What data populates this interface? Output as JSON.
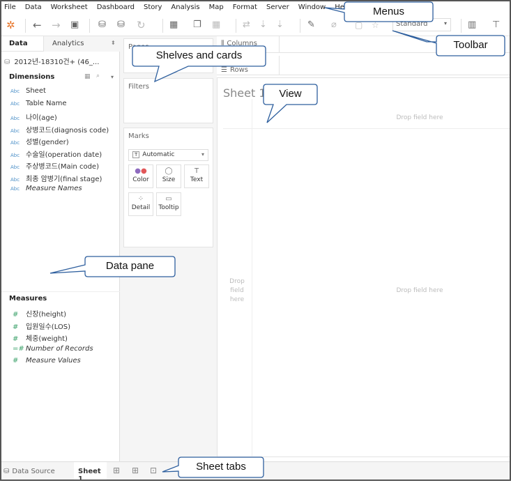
{
  "menus": [
    "File",
    "Data",
    "Worksheet",
    "Dashboard",
    "Story",
    "Analysis",
    "Map",
    "Format",
    "Server",
    "Window",
    "Help"
  ],
  "toolbar": {
    "icons": [
      "tableau-logo-icon",
      "back-icon",
      "forward-icon",
      "save-icon",
      "new-datasource-icon",
      "pause-updates-icon",
      "refresh-icon",
      "new-worksheet-icon",
      "duplicate-sheet-icon",
      "clear-sheet-icon",
      "swap-icon",
      "sort-ascending-icon",
      "sort-descending-icon",
      "highlight-icon",
      "group-icon",
      "label-icon",
      "pin-icon",
      "show-me-icon",
      "presentation-icon"
    ],
    "fit_select": "Standard"
  },
  "data_pane": {
    "tabs": [
      "Data",
      "Analytics"
    ],
    "datasource": "2012년-18310건+ (46_...",
    "dimensions_label": "Dimensions",
    "dimensions": [
      {
        "type": "Abc",
        "name": "Sheet",
        "italic": false
      },
      {
        "type": "Abc",
        "name": "Table Name",
        "italic": false
      },
      {
        "type": "Abc",
        "name": "나이(age)",
        "italic": false
      },
      {
        "type": "Abc",
        "name": "상병코드(diagnosis code)",
        "italic": false
      },
      {
        "type": "Abc",
        "name": "성별(gender)",
        "italic": false
      },
      {
        "type": "Abc",
        "name": "수술일(operation date)",
        "italic": false
      },
      {
        "type": "Abc",
        "name": "주상병코드(Main code)",
        "italic": false
      },
      {
        "type": "Abc",
        "name": "최종 암병기(final stage)",
        "italic": false
      },
      {
        "type": "Abc",
        "name": "Measure Names",
        "italic": true
      }
    ],
    "measures_label": "Measures",
    "measures": [
      {
        "type": "#",
        "name": "신장(height)",
        "italic": false
      },
      {
        "type": "#",
        "name": "입원일수(LOS)",
        "italic": false
      },
      {
        "type": "#",
        "name": "체중(weight)",
        "italic": false
      },
      {
        "type": "=#",
        "name": "Number of Records",
        "italic": true
      },
      {
        "type": "#",
        "name": "Measure Values",
        "italic": true
      }
    ]
  },
  "cards": {
    "pages": "Pages",
    "filters": "Filters",
    "marks": "Marks",
    "mark_type": "Automatic",
    "mark_buttons": [
      "Color",
      "Size",
      "Text",
      "Detail",
      "Tooltip"
    ]
  },
  "shelves": {
    "columns": "Columns",
    "rows": "Rows"
  },
  "view": {
    "title": "Sheet 1",
    "drop_top": "Drop field here",
    "drop_left": "Drop field here",
    "drop_center": "Drop field here"
  },
  "bottom": {
    "datasource_tab": "Data Source",
    "sheet_tab": "Sheet 1"
  },
  "callouts": {
    "menus": "Menus",
    "toolbar": "Toolbar",
    "shelves": "Shelves and cards",
    "view": "View",
    "data_pane": "Data pane",
    "sheet_tabs": "Sheet tabs"
  },
  "colors": {
    "callout_border": "#2e5f9e",
    "dimension_icon": "#4b8fc7",
    "measure_icon": "#3ea36c"
  }
}
